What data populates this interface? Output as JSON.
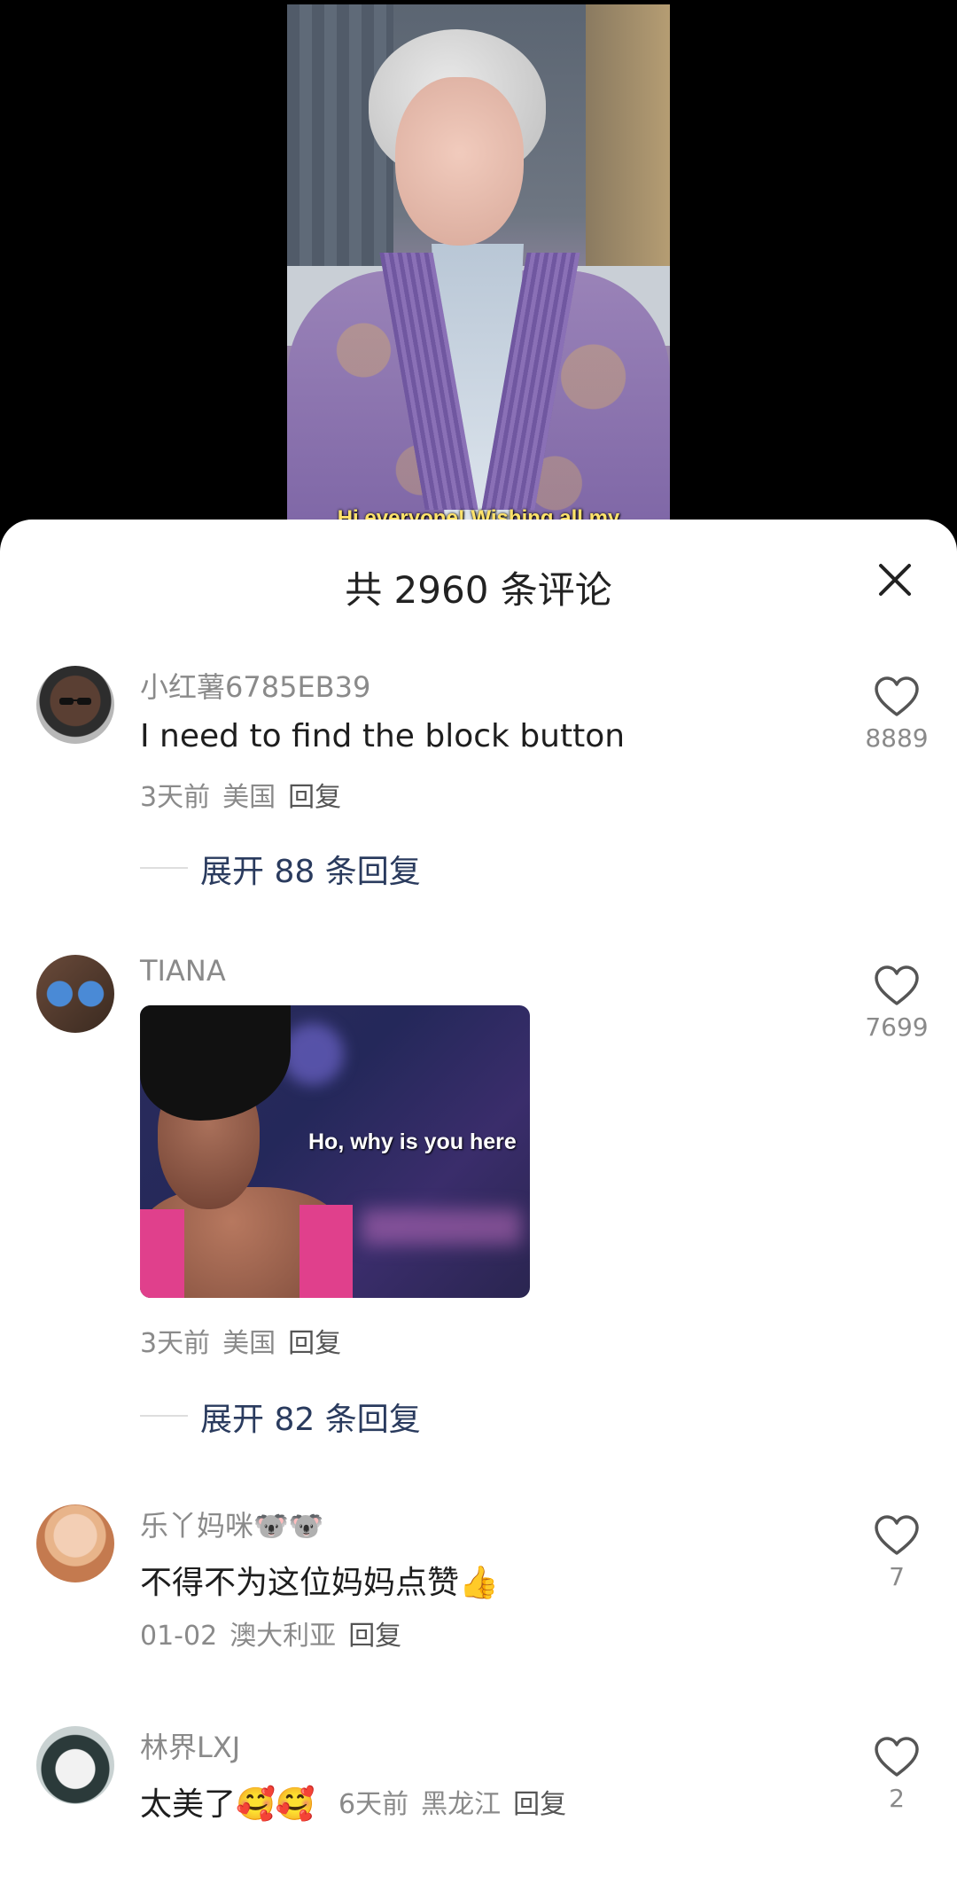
{
  "video": {
    "subtitle": "Hi everyone! Wishing all my"
  },
  "sheet": {
    "title": "共 2960 条评论",
    "close_icon": "close-icon"
  },
  "comments": [
    {
      "username": "小红薯6785EB39",
      "text": "I need to find the block button",
      "time": "3天前",
      "location": "美国",
      "reply": "回复",
      "likes": "8889",
      "expand": "展开 88 条回复"
    },
    {
      "username": "TIANA",
      "image_caption": "Ho, why is you here",
      "time": "3天前",
      "location": "美国",
      "reply": "回复",
      "likes": "7699",
      "expand": "展开 82 条回复"
    },
    {
      "username": "乐丫妈咪🐨🐨",
      "text": "不得不为这位妈妈点赞👍",
      "time": "01-02",
      "location": "澳大利亚",
      "reply": "回复",
      "likes": "7"
    },
    {
      "username": "林界LXJ",
      "text": "太美了🥰🥰",
      "time": "6天前",
      "location": "黑龙江",
      "reply": "回复",
      "likes": "2"
    }
  ],
  "colors": {
    "sheet_bg": "#ffffff",
    "expand_text": "#2a3b5e",
    "meta_text": "#8a8a8a",
    "subtitle": "#ffe36b"
  }
}
